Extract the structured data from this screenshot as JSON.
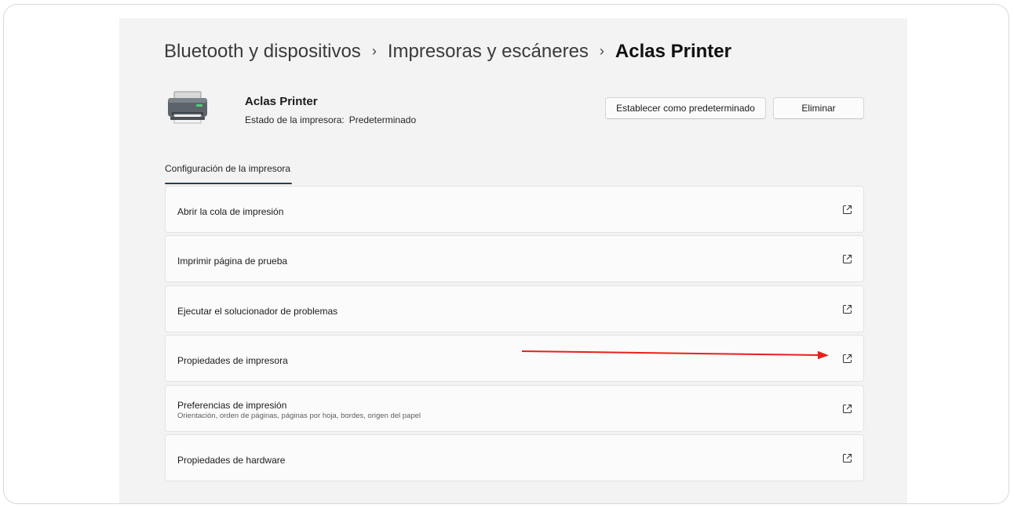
{
  "breadcrumb": {
    "level1": "Bluetooth y dispositivos",
    "level2": "Impresoras y escáneres",
    "current": "Aclas Printer",
    "separator": "›"
  },
  "printer": {
    "name": "Aclas Printer",
    "status_label": "Estado de la impresora:",
    "status_value": "Predeterminado",
    "icon": "printer-icon"
  },
  "actions": {
    "set_default": "Establecer como predeterminado",
    "remove": "Eliminar"
  },
  "tab": {
    "label": "Configuración de la impresora"
  },
  "settings": [
    {
      "label": "Abrir la cola de impresión",
      "icon": "open-external-icon"
    },
    {
      "label": "Imprimir página de prueba",
      "icon": "open-external-icon"
    },
    {
      "label": "Ejecutar el solucionador de problemas",
      "icon": "open-external-icon"
    },
    {
      "label": "Propiedades de impresora",
      "icon": "open-external-icon"
    },
    {
      "label": "Preferencias de impresión",
      "description": "Orientación, orden de páginas, páginas por hoja, bordes, origen del papel",
      "icon": "open-external-icon"
    },
    {
      "label": "Propiedades de hardware",
      "icon": "open-external-icon"
    }
  ],
  "annotation": {
    "type": "arrow",
    "color": "#e8211b"
  },
  "colors": {
    "panel_bg": "#f3f3f3",
    "card_bg": "#fbfbfb",
    "tab_accent": "#2e3e4a"
  }
}
